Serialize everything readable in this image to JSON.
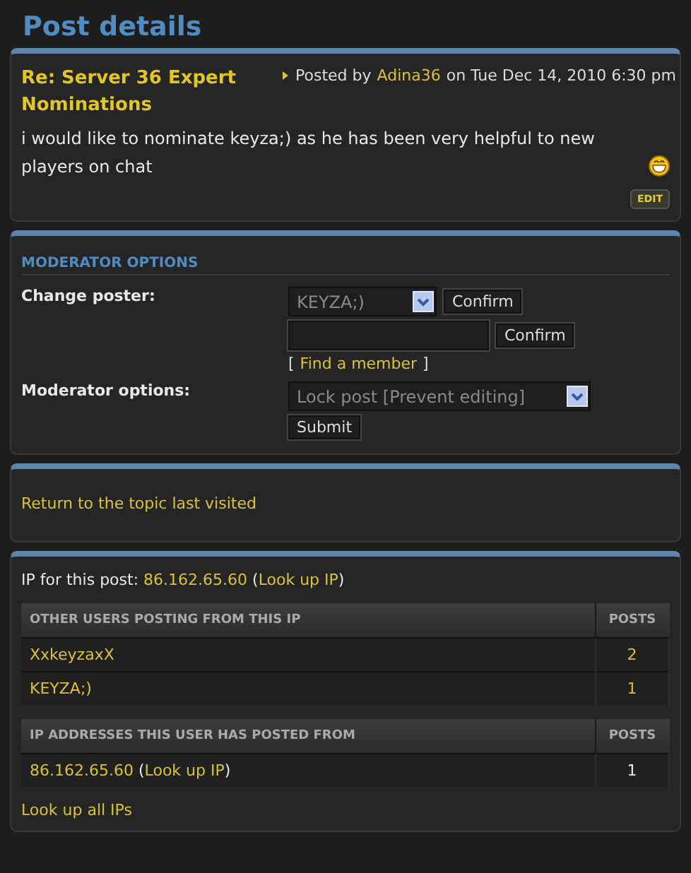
{
  "page_title": "Post details",
  "post": {
    "title": "Re: Server 36 Expert Nominations",
    "byline": [
      {
        "kind": "text",
        "text": "Posted by"
      },
      {
        "kind": "link",
        "text": "Adina36"
      },
      {
        "kind": "text",
        "text": "on Tue Dec 14, 2010 6:30 pm"
      }
    ],
    "body": "i would like to nominate keyza;) as he has been very helpful to new players on chat",
    "edit_button": "EDIT"
  },
  "moderator": {
    "heading": "MODERATOR OPTIONS",
    "change_poster": {
      "label": "Change poster:",
      "select_value": "KEYZA;)",
      "confirm": "Confirm",
      "input_confirm": "Confirm",
      "find_open": "[",
      "find_link": "Find a member",
      "find_close": "]"
    },
    "moderator_options": {
      "label": "Moderator options:",
      "select_value": "Lock post [Prevent editing]",
      "submit": "Submit"
    }
  },
  "return_link": "Return to the topic last visited",
  "ip_line": [
    {
      "kind": "text",
      "text": "IP for this post: "
    },
    {
      "kind": "link",
      "text": "86.162.65.60"
    },
    {
      "kind": "text",
      "text": " ("
    },
    {
      "kind": "link",
      "text": "Look up IP"
    },
    {
      "kind": "text",
      "text": ")"
    }
  ],
  "tables": [
    {
      "columns": [
        "OTHER USERS POSTING FROM THIS IP",
        "POSTS"
      ],
      "rows": [
        {
          "cell": [
            {
              "kind": "link",
              "text": "XxkeyzaxX"
            }
          ],
          "posts": {
            "kind": "link",
            "text": "2"
          }
        },
        {
          "cell": [
            {
              "kind": "link",
              "text": "KEYZA;)"
            }
          ],
          "posts": {
            "kind": "link",
            "text": "1"
          }
        }
      ]
    },
    {
      "columns": [
        "IP ADDRESSES THIS USER HAS POSTED FROM",
        "POSTS"
      ],
      "rows": [
        {
          "cell": [
            {
              "kind": "link",
              "text": "86.162.65.60"
            },
            {
              "kind": "text",
              "text": " ("
            },
            {
              "kind": "link",
              "text": "Look up IP"
            },
            {
              "kind": "text",
              "text": ")"
            }
          ],
          "posts": {
            "kind": "text",
            "text": "1"
          }
        }
      ]
    }
  ],
  "all_ips_link": "Look up all IPs"
}
